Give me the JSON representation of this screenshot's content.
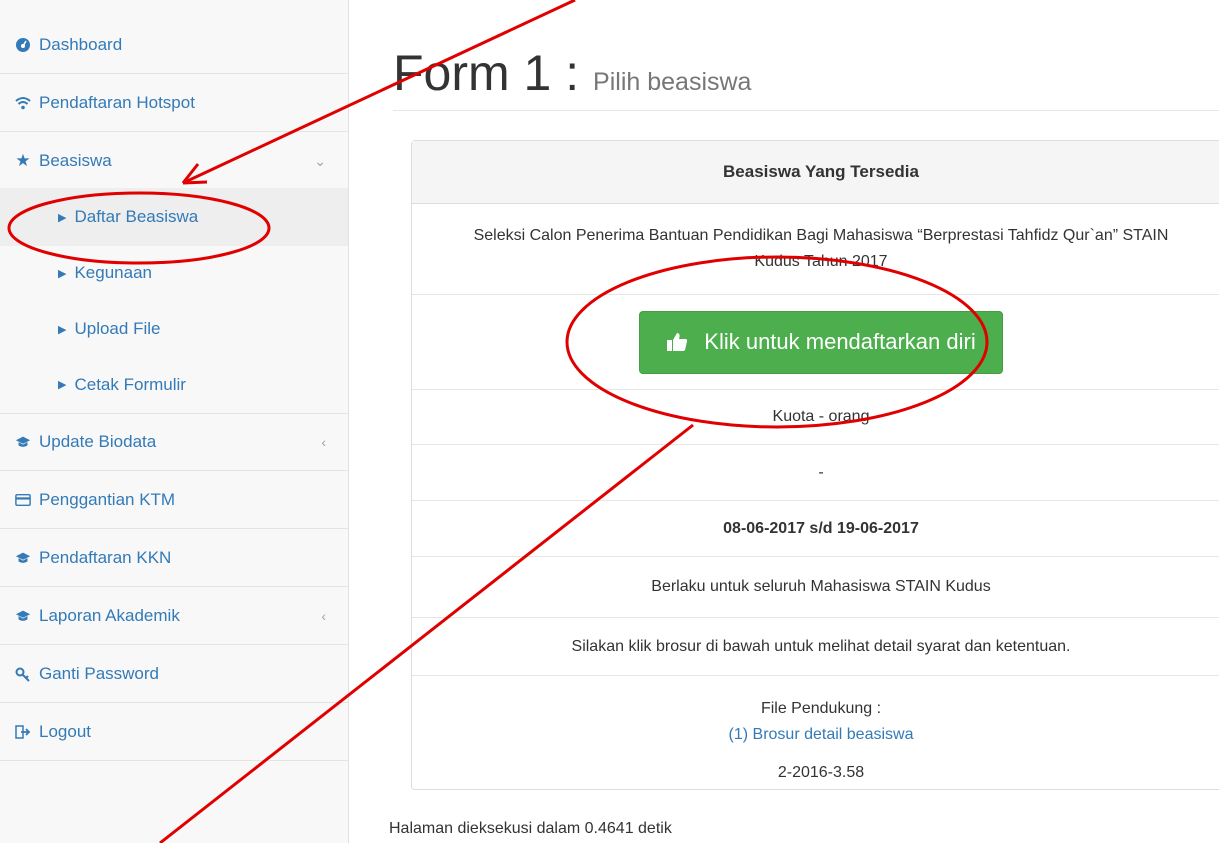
{
  "sidebar": {
    "items": [
      {
        "label": "Dashboard",
        "icon": "dashboard-icon"
      },
      {
        "label": "Pendaftaran Hotspot",
        "icon": "wifi-icon"
      },
      {
        "label": "Beasiswa",
        "icon": "star-icon"
      },
      {
        "label": "Update Biodata",
        "icon": "graduation-cap-icon"
      },
      {
        "label": "Penggantian KTM",
        "icon": "credit-card-icon"
      },
      {
        "label": "Pendaftaran KKN",
        "icon": "graduation-cap-icon"
      },
      {
        "label": "Laporan Akademik",
        "icon": "graduation-cap-icon"
      },
      {
        "label": "Ganti Password",
        "icon": "key-icon"
      },
      {
        "label": "Logout",
        "icon": "sign-out-icon"
      }
    ],
    "beasiswa_sub": [
      {
        "label": "Daftar Beasiswa",
        "active": true
      },
      {
        "label": "Kegunaan",
        "active": false
      },
      {
        "label": "Upload File",
        "active": false
      },
      {
        "label": "Cetak Formulir",
        "active": false
      }
    ]
  },
  "main": {
    "title": "Form 1 :",
    "subtitle": "Pilih beasiswa",
    "panel": {
      "heading": "Beasiswa Yang Tersedia",
      "description": "Seleksi Calon Penerima Bantuan Pendidikan Bagi Mahasiswa “Berprestasi Tahfidz Qur`an” STAIN Kudus Tahun 2017",
      "register_button": "Klik untuk mendaftarkan diri",
      "kuota": "Kuota - orang",
      "dash": "-",
      "period": "08-06-2017 s/d 19-06-2017",
      "applies_to": "Berlaku untuk seluruh Mahasiswa STAIN Kudus",
      "instruction": "Silakan klik brosur di bawah untuk melihat detail syarat dan ketentuan.",
      "file_label": "File Pendukung :",
      "file_link": "(1) Brosur detail beasiswa",
      "code": "2-2016-3.58"
    },
    "footer": "Halaman dieksekusi dalam 0.4641 detik"
  },
  "colors": {
    "link": "#337ab7",
    "button_green": "#4cae4c",
    "annotation_red": "#e00000"
  }
}
